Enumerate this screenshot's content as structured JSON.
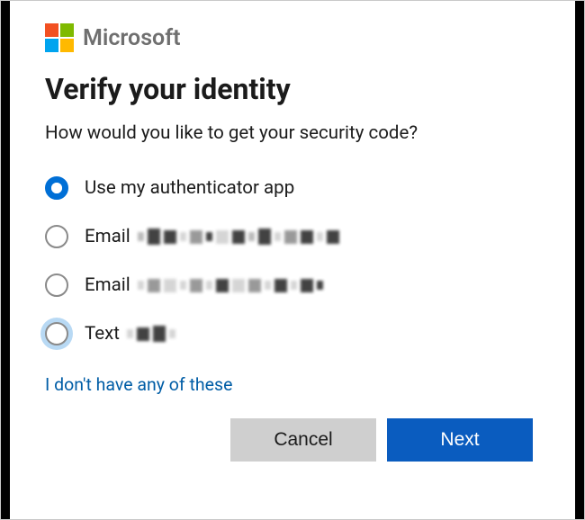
{
  "brand": {
    "name": "Microsoft"
  },
  "heading": "Verify your identity",
  "subhead": "How would you like to get your security code?",
  "options": [
    {
      "label": "Use my authenticator app",
      "selected": true,
      "redacted": false,
      "halo": false
    },
    {
      "label": "Email",
      "selected": false,
      "redacted": true,
      "halo": false
    },
    {
      "label": "Email",
      "selected": false,
      "redacted": true,
      "halo": false
    },
    {
      "label": "Text",
      "selected": false,
      "redacted": true,
      "halo": true
    }
  ],
  "link": "I don't have any of these",
  "buttons": {
    "cancel": "Cancel",
    "next": "Next"
  },
  "colors": {
    "accent": "#0a5cbf",
    "link": "#005da6"
  }
}
